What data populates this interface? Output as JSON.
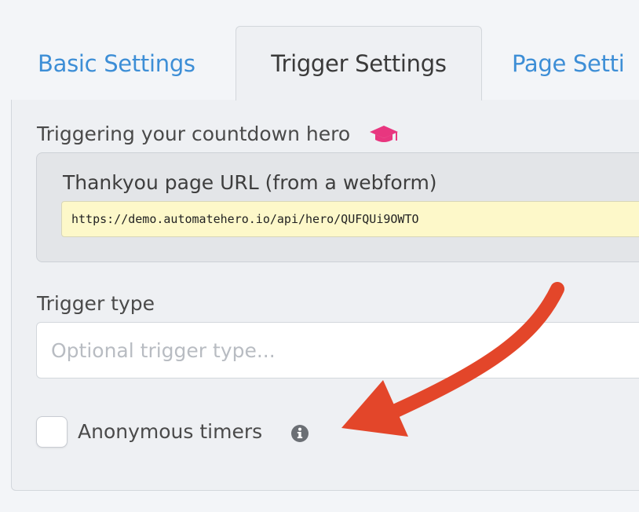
{
  "tabs": [
    {
      "label": "Basic Settings"
    },
    {
      "label": "Trigger Settings"
    },
    {
      "label": "Page Setti"
    }
  ],
  "section": {
    "title": "Triggering your countdown hero",
    "icon": "graduation-cap-icon"
  },
  "url_box": {
    "label": "Thankyou page URL (from a webform)",
    "value": "https://demo.automatehero.io/api/hero/QUFQUi9OWTO"
  },
  "trigger_type": {
    "label": "Trigger type",
    "placeholder": "Optional trigger type..."
  },
  "anonymous": {
    "label": "Anonymous timers",
    "checked": false,
    "info_icon": "info-icon"
  },
  "colors": {
    "accent": "#3d8ed6",
    "cap": "#e8367f",
    "arrow": "#e3462a",
    "url_bg": "#fdf8c9"
  }
}
